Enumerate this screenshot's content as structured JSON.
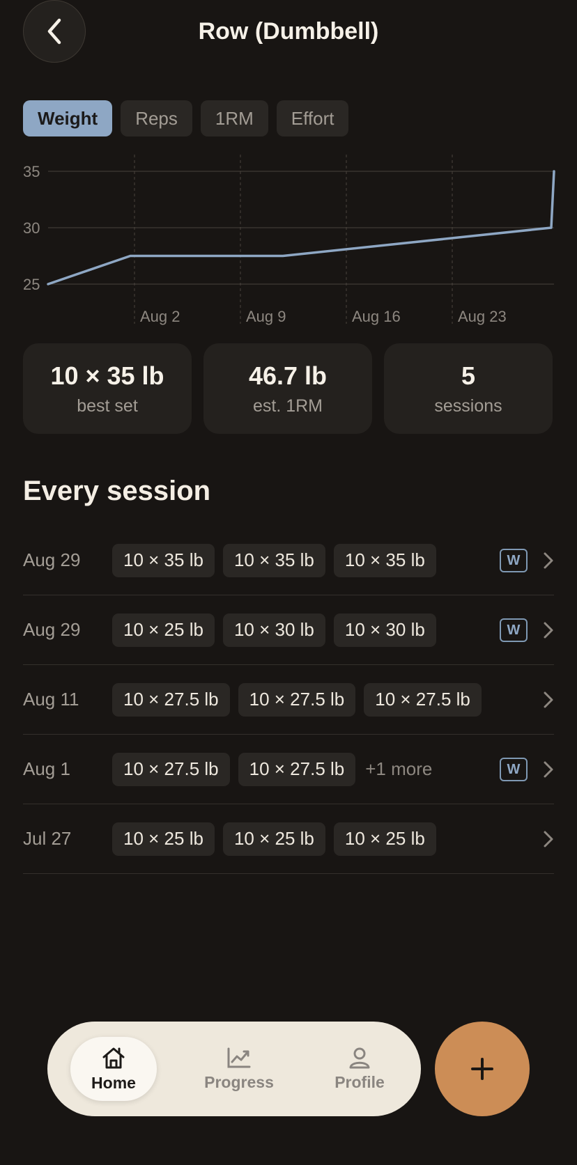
{
  "header": {
    "title": "Row (Dumbbell)"
  },
  "tabs": [
    {
      "label": "Weight",
      "active": true
    },
    {
      "label": "Reps",
      "active": false
    },
    {
      "label": "1RM",
      "active": false
    },
    {
      "label": "Effort",
      "active": false
    }
  ],
  "chart_data": {
    "type": "line",
    "title": "",
    "xlabel": "",
    "ylabel": "",
    "ylim": [
      25,
      35
    ],
    "yticks": [
      "35",
      "30",
      "25"
    ],
    "xticks": [
      "Aug 2",
      "Aug 9",
      "Aug 16",
      "Aug 23"
    ],
    "x": [
      "Jul 27",
      "Aug 1",
      "Aug 11",
      "Aug 29",
      "Aug 29"
    ],
    "series": [
      {
        "values": [
          25,
          27.5,
          27.5,
          30,
          35
        ]
      }
    ],
    "grid": true,
    "line_color": "#8ea7c4"
  },
  "stats": [
    {
      "value": "10 × 35 lb",
      "label": "best set"
    },
    {
      "value": "46.7 lb",
      "label": "est. 1RM"
    },
    {
      "value": "5",
      "label": "sessions"
    }
  ],
  "section": {
    "title": "Every session"
  },
  "sessions": [
    {
      "date": "Aug 29",
      "sets": [
        "10 × 35 lb",
        "10 × 35 lb",
        "10 × 35 lb"
      ],
      "more": "",
      "badge": "W"
    },
    {
      "date": "Aug 29",
      "sets": [
        "10 × 25 lb",
        "10 × 30 lb",
        "10 × 30 lb"
      ],
      "more": "",
      "badge": "W"
    },
    {
      "date": "Aug 11",
      "sets": [
        "10 × 27.5 lb",
        "10 × 27.5 lb",
        "10 × 27.5 lb"
      ],
      "more": "",
      "badge": ""
    },
    {
      "date": "Aug 1",
      "sets": [
        "10 × 27.5 lb",
        "10 × 27.5 lb"
      ],
      "more": "+1 more",
      "badge": "W"
    },
    {
      "date": "Jul 27",
      "sets": [
        "10 × 25 lb",
        "10 × 25 lb",
        "10 × 25 lb"
      ],
      "more": "",
      "badge": ""
    }
  ],
  "nav": {
    "items": [
      {
        "label": "Home",
        "icon": "home-icon",
        "active": true
      },
      {
        "label": "Progress",
        "icon": "chart-icon",
        "active": false
      },
      {
        "label": "Profile",
        "icon": "user-icon",
        "active": false
      }
    ],
    "fab_icon": "plus-icon"
  },
  "colors": {
    "background": "#181513",
    "accent": "#8ea7c4",
    "fab": "#cc8d56",
    "nav_bg": "#eee8dc"
  }
}
